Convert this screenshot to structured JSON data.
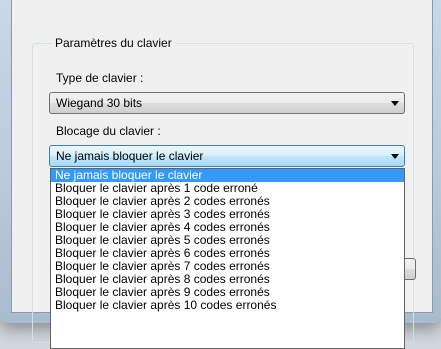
{
  "keyboard_group": {
    "title": "Paramètres du clavier",
    "keyboard_type_label": "Type de clavier :",
    "keyboard_type_value": "Wiegand 30 bits",
    "lock_label": "Blocage du clavier :",
    "lock_value": "Ne jamais bloquer le clavier"
  },
  "lock_options": [
    "Ne jamais bloquer le clavier",
    "Bloquer le clavier après 1 code erroné",
    "Bloquer le clavier après 2 codes erronés",
    "Bloquer le clavier après 3 codes erronés",
    "Bloquer le clavier après 4 codes erronés",
    "Bloquer le clavier après 5 codes erronés",
    "Bloquer le clavier après 6 codes erronés",
    "Bloquer le clavier après 7 codes erronés",
    "Bloquer le clavier après 8 codes erronés",
    "Bloquer le clavier après 9 codes erronés",
    "Bloquer le clavier après 10 codes erronés"
  ],
  "selected_option_index": 0,
  "icons": {
    "dropdown_arrow": "chevron-down-icon"
  }
}
